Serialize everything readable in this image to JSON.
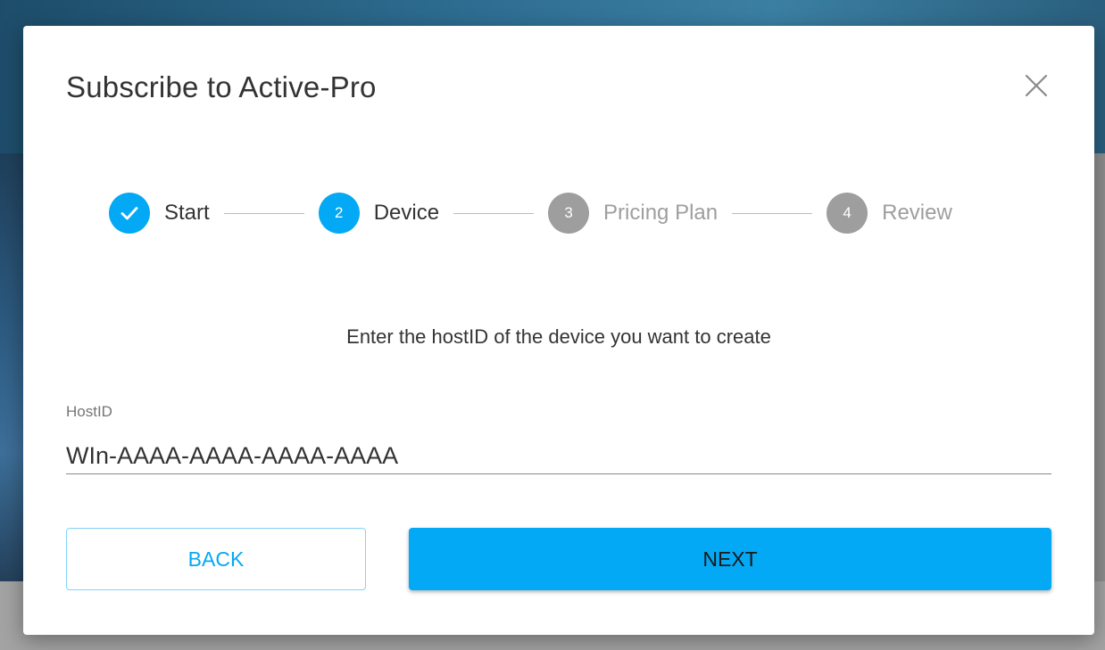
{
  "dialog": {
    "title": "Subscribe to Active-Pro"
  },
  "stepper": {
    "steps": [
      {
        "number": "1",
        "label": "Start",
        "state": "completed"
      },
      {
        "number": "2",
        "label": "Device",
        "state": "active"
      },
      {
        "number": "3",
        "label": "Pricing Plan",
        "state": "pending"
      },
      {
        "number": "4",
        "label": "Review",
        "state": "pending"
      }
    ]
  },
  "form": {
    "instruction": "Enter the hostID of the device you want to create",
    "hostid_label": "HostID",
    "hostid_value": "WIn-AAAA-AAAA-AAAA-AAAA"
  },
  "buttons": {
    "back_label": "BACK",
    "next_label": "NEXT"
  },
  "colors": {
    "accent": "#03a9f4",
    "pending": "#9e9e9e",
    "text": "#333333"
  },
  "icons": {
    "close": "close-icon",
    "check": "check-icon"
  }
}
